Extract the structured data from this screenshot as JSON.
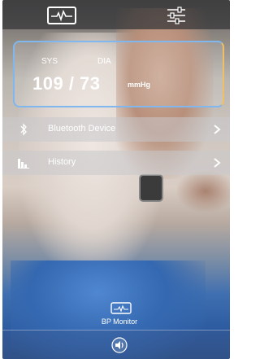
{
  "readout": {
    "sys_label": "SYS",
    "dia_label": "DIA",
    "value": "109 / 73",
    "unit": "mmHg"
  },
  "menu": {
    "items": [
      {
        "label": "Bluetooth Device",
        "icon": "bluetooth-icon"
      },
      {
        "label": "History",
        "icon": "bar-chart-icon"
      }
    ]
  },
  "tabbar": {
    "label": "BP Monitor",
    "icon": "monitor-icon"
  },
  "header": {
    "left_icon": "heart-monitor-icon",
    "right_icon": "settings-sliders-icon"
  },
  "colors": {
    "accent_blue": "#7fb7ee",
    "accent_gold": "#f0c060"
  }
}
